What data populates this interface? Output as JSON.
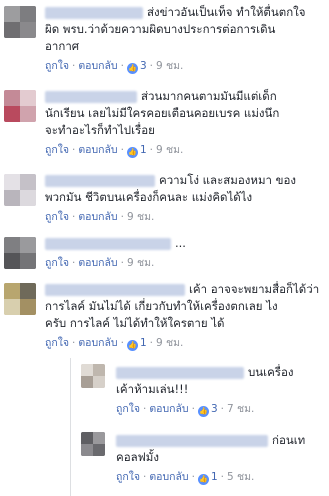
{
  "like_label": "ถูกใจ",
  "reply_label": "ตอบกลับ",
  "like_icon": "thumbs-up-icon",
  "colors": {
    "link": "#4267b2",
    "meta": "#90949c",
    "like_badge": "#5890ff"
  },
  "comments": [
    {
      "text": "ส่งข่าวอันเป็นเท็จ ทำให้ตื่นตกใจ\nผิด พรบ.ว่าด้วยความผิดบางประการต่อการเดิน\nอากาศ",
      "likes": "3",
      "time": "9 ชม."
    },
    {
      "text": "ส่วนมากคนตามมันมีแต่เด็ก\nนักเรียน เลยไม่มีใครคอยเตือนคอยเบรค แม่งนึก\nจะทำอะไรก็ทำไปเรื่อย",
      "likes": "1",
      "time": "9 ชม."
    },
    {
      "text": "ความโง่ และสมองหมา ของ\nพวกมัน ชีวิตบนเครื่องก็คนละ แม่งคิดได้ไง",
      "time": "9 ชม."
    },
    {
      "text": "...",
      "time": "9 ชม."
    },
    {
      "text": "เค้า อาจจะพยามสื่อก็ได้ว่า\nการไลค์ มันไม่ได้ เกี่ยวกับทำให้เครื่องตกเลย ไง\nครับ การไลค์ ไม่ได้ทำให้ใครตาย ได้",
      "likes": "1",
      "time": "9 ชม."
    }
  ],
  "replies": [
    {
      "text": "บนเครื่อง\nเค้าห้ามเล่น!!!",
      "likes": "3",
      "time": "7 ชม."
    },
    {
      "text": "ก่อนเท\nคอลฟมั้ง",
      "likes": "1",
      "time": "5 ชม."
    }
  ]
}
